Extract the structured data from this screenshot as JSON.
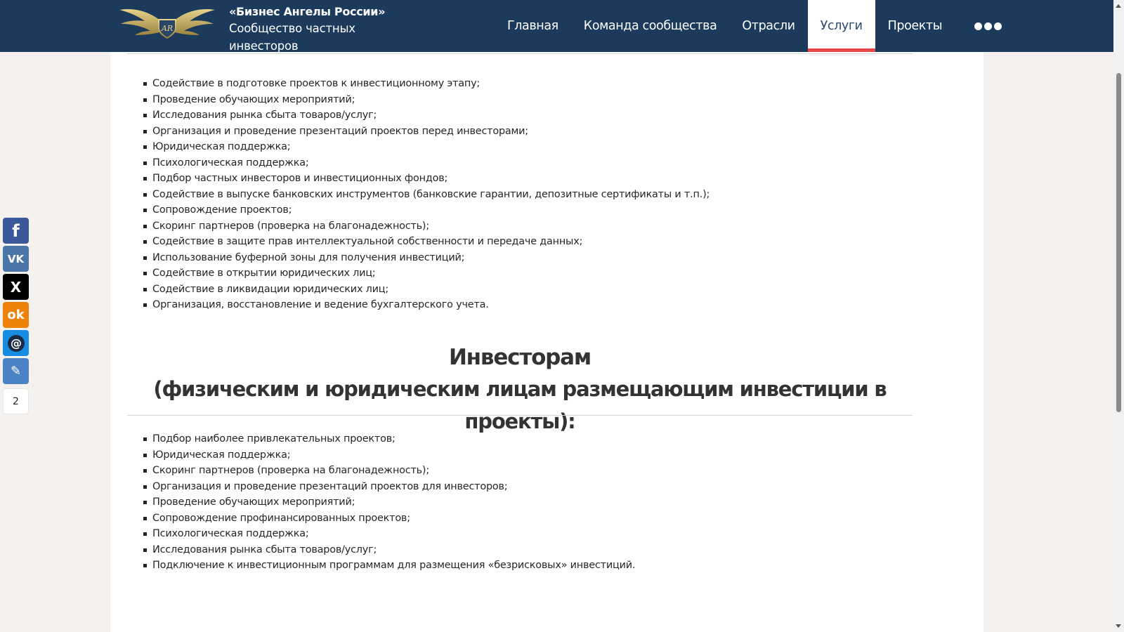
{
  "header": {
    "brand_title": "«Бизнес Ангелы России»",
    "brand_subtitle": "Сообщество частных инвесторов",
    "nav": [
      {
        "label": "Главная",
        "active": false
      },
      {
        "label": "Команда сообщества",
        "active": false
      },
      {
        "label": "Отрасли",
        "active": false
      },
      {
        "label": "Услуги",
        "active": true
      },
      {
        "label": "Проекты",
        "active": false
      }
    ],
    "more_icon": "more-dots-icon"
  },
  "projects_list": [
    "Содействие в подготовке проектов к инвестиционному этапу;",
    "Проведение обучающих мероприятий;",
    "Исследования рынка сбыта товаров/услуг;",
    "Организация и проведение презентаций проектов перед инвесторами;",
    "Юридическая поддержка;",
    "Психологическая поддержка;",
    "Подбор частных инвесторов и инвестиционных фондов;",
    "Содействие в выпуске банковских инструментов (банковские гарантии, депозитные сертификаты и т.п.);",
    "Сопровождение проектов;",
    "Скоринг партнеров (проверка на благонадежность);",
    "Содействие в защите прав интеллектуальной собственности и передаче данных;",
    "Использование буферной зоны для получения инвестиций;",
    "Содействие в открытии юридических лиц;",
    "Содействие в ликвидации юридических лиц;",
    "Организация, восстановление и ведение бухгалтерского учета."
  ],
  "investors": {
    "heading": "Инвесторам",
    "subheading": "(физическим и юридическим лицам размещающим инвестиции в проекты):",
    "items": [
      "Подбор наиболее привлекательных проектов;",
      "Юридическая поддержка;",
      "Скоринг партнеров (проверка на благонадежность);",
      "Организация и проведение презентаций проектов для инвесторов;",
      "Проведение обучающих мероприятий;",
      "Сопровождение профинансированных проектов;",
      "Психологическая поддержка;",
      "Исследования рынка сбыта товаров/услуг;",
      "Подключение к инвестиционным программам для размещения «безрисковых» инвестиций."
    ]
  },
  "share": {
    "buttons": [
      {
        "icon": "facebook-icon",
        "glyph": "f",
        "color": "#3b5998"
      },
      {
        "icon": "vk-icon",
        "glyph": "VK",
        "color": "#4a76a8"
      },
      {
        "icon": "x-twitter-icon",
        "glyph": "X",
        "color": "#000000"
      },
      {
        "icon": "odnoklassniki-icon",
        "glyph": "ok",
        "color": "#ee8208"
      },
      {
        "icon": "mail-ru-icon",
        "glyph": "@",
        "color": "#168de2"
      },
      {
        "icon": "livejournal-icon",
        "glyph": "✎",
        "color": "#4a82c4"
      }
    ],
    "count": "2"
  },
  "colors": {
    "header_bg": "#1b3a5c",
    "active_underline": "#e84848",
    "page_bg": "#f4f1ee"
  }
}
